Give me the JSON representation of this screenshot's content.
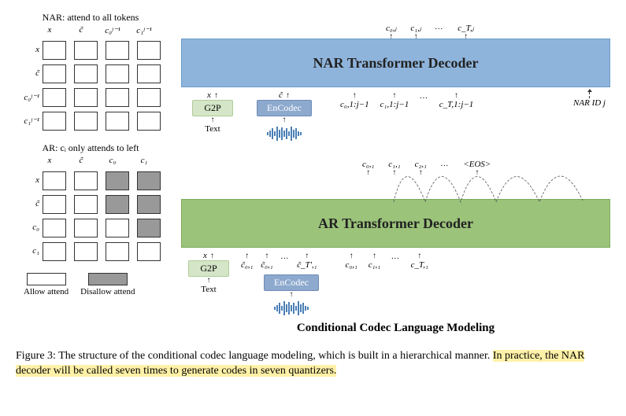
{
  "left": {
    "nar_title": "NAR:  attend to all tokens",
    "ar_title": "AR: cᵢ only attends to left",
    "nar_cols": [
      "x",
      "c̃",
      "c₀ʲ⁻¹",
      "c₁ʲ⁻¹"
    ],
    "nar_rows": [
      "x",
      "c̃",
      "c₀ʲ⁻¹",
      "c₁ʲ⁻¹"
    ],
    "ar_cols": [
      "x",
      "c̃",
      "c₀",
      "c₁"
    ],
    "ar_rows": [
      "x",
      "c̃",
      "c₀",
      "c₁"
    ],
    "legend_allow": "Allow attend",
    "legend_disallow": "Disallow attend"
  },
  "nar": {
    "title": "NAR Transformer Decoder",
    "out": [
      "c₀,ⱼ",
      "c₁,ⱼ",
      "...",
      "c_T,ⱼ"
    ],
    "x_label": "x",
    "c_tilde": "c̃",
    "g2p": "G2P",
    "encodec": "EnCodec",
    "text": "Text",
    "tokens": [
      "c₀,1:j−1",
      "c₁,1:j−1",
      "...",
      "c_T,1:j−1"
    ],
    "nar_id": "NAR ID j"
  },
  "ar": {
    "title": "AR Transformer Decoder",
    "out": [
      "c₀,₁",
      "c₁,₁",
      "c₂,₁",
      "...",
      "<EOS>"
    ],
    "x_label": "x",
    "g2p": "G2P",
    "encodec": "EnCodec",
    "text": "Text",
    "tokens_left": [
      "c̃₀,₁",
      "c̃₀,₁",
      "...",
      "c̃_T',₁"
    ],
    "tokens_right": [
      "c₀,₁",
      "c₁,₁",
      "...",
      "c_T,₁"
    ]
  },
  "subtitle": "Conditional Codec Language Modeling",
  "caption": {
    "prefix": "Figure 3: The structure of the conditional codec language modeling, which is built in a hierarchical manner. ",
    "highlight": "In practice, the NAR decoder will be called seven times to generate codes in seven quantizers."
  },
  "ar_mask": [
    [
      0,
      0,
      1,
      1
    ],
    [
      0,
      0,
      1,
      1
    ],
    [
      0,
      0,
      0,
      1
    ],
    [
      0,
      0,
      0,
      0
    ]
  ]
}
